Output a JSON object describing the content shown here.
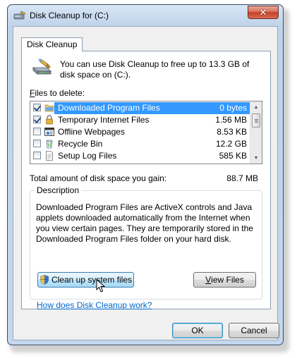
{
  "window": {
    "title": "Disk Cleanup for  (C:)",
    "close_glyph": "✕"
  },
  "tabs": [
    {
      "label": "Disk Cleanup",
      "selected": true
    }
  ],
  "intro": {
    "text": "You can use Disk Cleanup to free up to 13.3 GB of disk space on  (C:).",
    "icon": "disk-cleanup-icon"
  },
  "files": {
    "label_accel": "F",
    "label_rest": "iles to delete:",
    "items": [
      {
        "name": "Downloaded Program Files",
        "size": "0 bytes",
        "checked": true,
        "selected": true,
        "icon": "folder-icon"
      },
      {
        "name": "Temporary Internet Files",
        "size": "1.56 MB",
        "checked": true,
        "selected": false,
        "icon": "lock-icon"
      },
      {
        "name": "Offline Webpages",
        "size": "8.53 KB",
        "checked": false,
        "selected": false,
        "icon": "webpage-icon"
      },
      {
        "name": "Recycle Bin",
        "size": "12.2 GB",
        "checked": false,
        "selected": false,
        "icon": "recycle-bin-icon"
      },
      {
        "name": "Setup Log Files",
        "size": "585 KB",
        "checked": false,
        "selected": false,
        "icon": "document-icon"
      }
    ]
  },
  "total": {
    "label": "Total amount of disk space you gain:",
    "value": "88.7 MB"
  },
  "description": {
    "legend": "Description",
    "text": "Downloaded Program Files are ActiveX controls and Java applets downloaded automatically from the Internet when you view certain pages. They are temporarily stored in the Downloaded Program Files folder on your hard disk."
  },
  "buttons": {
    "cleanup_system": "Clean up system files",
    "view_files_accel": "V",
    "view_files_rest": "iew Files",
    "ok": "OK",
    "cancel": "Cancel"
  },
  "help_link": "How does Disk Cleanup work?",
  "colors": {
    "selection": "#3399ff",
    "link": "#0066cc",
    "close_button": "#c2412a"
  }
}
